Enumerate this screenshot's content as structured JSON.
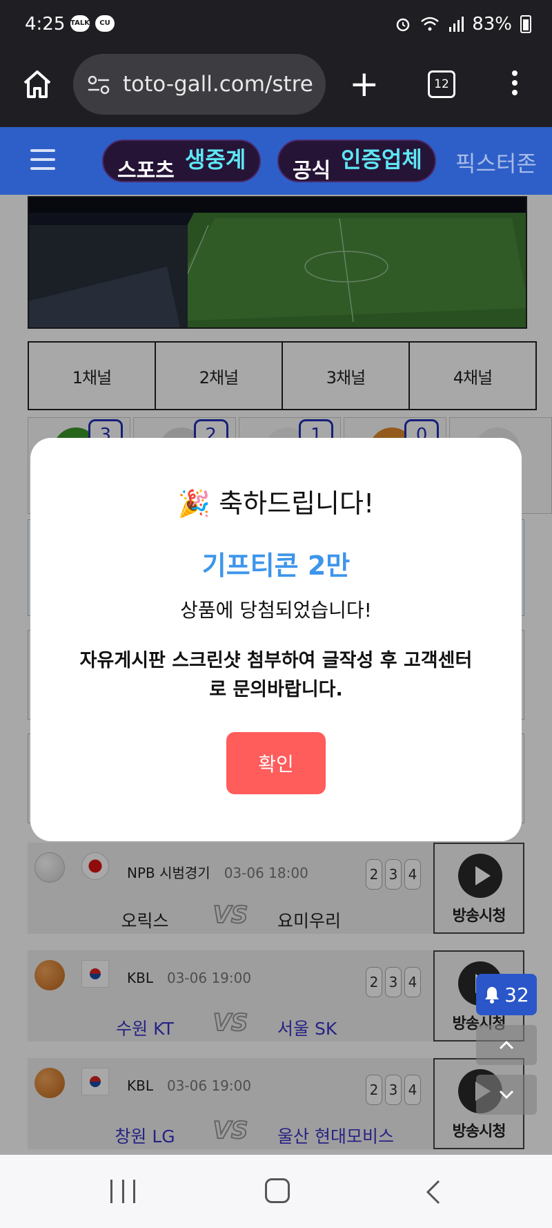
{
  "status_bar": {
    "time": "4:25",
    "notif_icons": [
      "TALK",
      "CU"
    ],
    "battery": "83%"
  },
  "browser": {
    "url": "toto-gall.com/stre",
    "tab_count": "12"
  },
  "site_header": {
    "pill1": {
      "white": "스포츠",
      "glow": "생중계"
    },
    "pill2": {
      "white": "공식",
      "glow": "인증업체"
    },
    "right_text": "픽스터존"
  },
  "channels": [
    "1채널",
    "2채널",
    "3채널",
    "4채널"
  ],
  "sports": [
    {
      "icon": "soccer-ball-icon",
      "count": "3",
      "color": "#3a9a2a"
    },
    {
      "icon": "soccer-ball-icon",
      "count": "2",
      "color": "#dddddd"
    },
    {
      "icon": "baseball-icon",
      "count": "1",
      "color": "#eeeeee"
    },
    {
      "icon": "basketball-icon",
      "count": "0",
      "color": "#e08a2c"
    },
    {
      "icon": "volleyball-icon",
      "count": "",
      "color": "#e8e8e8"
    }
  ],
  "matches": [
    {
      "sport_icon": "baseball-icon",
      "flag": "japan-flag-icon",
      "league": "NPB 시범경기",
      "time": "03-06 18:00",
      "nums": [
        "2",
        "3",
        "4"
      ],
      "team1": "오릭스",
      "team2": "요미우리",
      "team_color": "#222222",
      "watch_label": "방송시청"
    },
    {
      "sport_icon": "basketball-icon",
      "flag": "korea-flag-icon",
      "league": "KBL",
      "time": "03-06 19:00",
      "nums": [
        "2",
        "3",
        "4"
      ],
      "team1": "수원 KT",
      "team2": "서울 SK",
      "team_color": "#3a35c8",
      "watch_label": "방송시청"
    },
    {
      "sport_icon": "basketball-icon",
      "flag": "korea-flag-icon",
      "league": "KBL",
      "time": "03-06 19:00",
      "nums": [
        "2",
        "3",
        "4"
      ],
      "team1": "창원 LG",
      "team2": "울산 현대모비스",
      "team_color": "#3a35c8",
      "watch_label": "방송시청"
    }
  ],
  "modal": {
    "title": "🎉 축하드립니다!",
    "prize": "기프티콘 2만",
    "won": "상품에 당첨되었습니다!",
    "instruction": "자유게시판 스크린샷 첨부하여 글작성 후 고객센터로 문의바랍니다.",
    "ok_label": "확인"
  },
  "floating": {
    "notif_count": "32"
  },
  "colors": {
    "header_blue": "#2e5fc8",
    "prize_blue": "#3e95ea",
    "ok_red": "#ff5c5c",
    "count_blue": "#2230b8"
  }
}
